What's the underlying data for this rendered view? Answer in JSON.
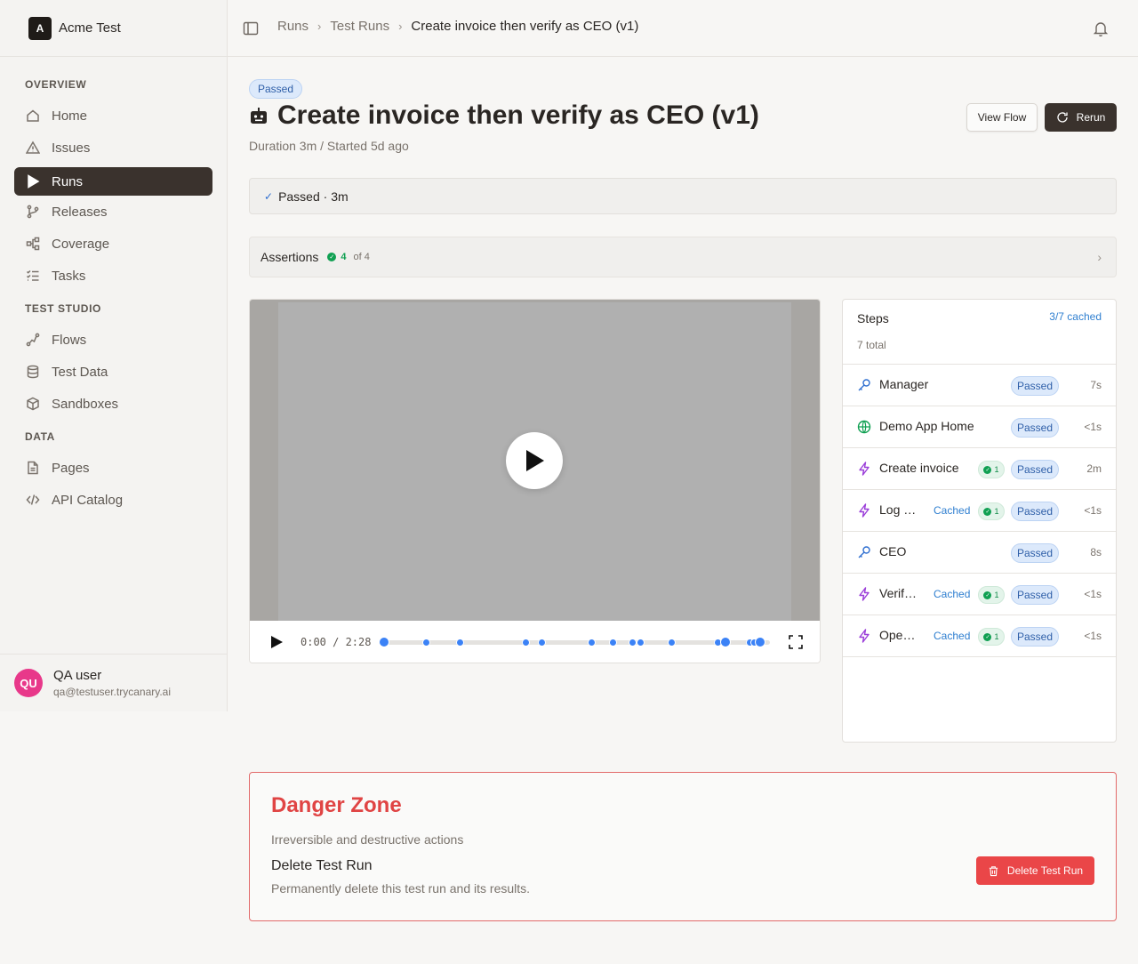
{
  "workspace": {
    "logo_letter": "A",
    "name": "Acme Test"
  },
  "sidebar": {
    "sections": [
      {
        "title": "OVERVIEW"
      },
      {
        "title": "TEST STUDIO"
      },
      {
        "title": "DATA"
      }
    ],
    "items": [
      {
        "label": "Home",
        "icon": "home-icon"
      },
      {
        "label": "Issues",
        "icon": "warning-icon"
      },
      {
        "label": "Runs",
        "icon": "play-icon",
        "active": true
      },
      {
        "label": "Releases",
        "icon": "git-branch-icon"
      },
      {
        "label": "Coverage",
        "icon": "workflow-icon"
      },
      {
        "label": "Tasks",
        "icon": "checklist-icon"
      },
      {
        "label": "Flows",
        "icon": "route-icon"
      },
      {
        "label": "Test Data",
        "icon": "database-icon"
      },
      {
        "label": "Sandboxes",
        "icon": "box-icon"
      },
      {
        "label": "Pages",
        "icon": "file-icon"
      },
      {
        "label": "API Catalog",
        "icon": "code-icon"
      }
    ],
    "user": {
      "initials": "QU",
      "name": "QA user",
      "email": "qa@testuser.trycanary.ai"
    }
  },
  "breadcrumb": [
    "Runs",
    "Test Runs",
    "Create invoice then verify as CEO (v1)"
  ],
  "header": {
    "status_badge": "Passed",
    "title": "Create invoice then verify as CEO (v1)",
    "subtitle": "Duration 3m / Started 5d ago",
    "view_flow_label": "View Flow",
    "rerun_label": "Rerun"
  },
  "status_bar": {
    "text": "Passed · 3m"
  },
  "assertions": {
    "label": "Assertions",
    "passed": "4",
    "total_text": "of 4"
  },
  "video": {
    "current_time": "0:00",
    "duration": "2:28",
    "time_text": "0:00 / 2:28",
    "markers": [
      0.0,
      0.113,
      0.202,
      0.374,
      0.416,
      0.546,
      0.6,
      0.653,
      0.674,
      0.755,
      0.875,
      0.897,
      0.958,
      0.97,
      0.988
    ],
    "accent": "#3b82f6"
  },
  "steps": {
    "title": "Steps",
    "cached_summary": "3/7 cached",
    "total_text": "7 total",
    "items": [
      {
        "name": "Manager",
        "icon": "key-icon",
        "cached": "",
        "assertions": "",
        "status": "Passed",
        "duration": "7s"
      },
      {
        "name": "Demo App Home",
        "icon": "globe-icon",
        "cached": "",
        "assertions": "",
        "status": "Passed",
        "duration": "<1s"
      },
      {
        "name": "Create invoice",
        "icon": "lightning-icon",
        "cached": "",
        "assertions": "1",
        "status": "Passed",
        "duration": "2m"
      },
      {
        "name": "Log …",
        "icon": "lightning-icon",
        "cached": "Cached",
        "assertions": "1",
        "status": "Passed",
        "duration": "<1s"
      },
      {
        "name": "CEO",
        "icon": "key-icon",
        "cached": "",
        "assertions": "",
        "status": "Passed",
        "duration": "8s"
      },
      {
        "name": "Verif…",
        "icon": "lightning-icon",
        "cached": "Cached",
        "assertions": "1",
        "status": "Passed",
        "duration": "<1s"
      },
      {
        "name": "Ope…",
        "icon": "lightning-icon",
        "cached": "Cached",
        "assertions": "1",
        "status": "Passed",
        "duration": "<1s"
      }
    ]
  },
  "danger_zone": {
    "title": "Danger Zone",
    "subtitle": "Irreversible and destructive actions",
    "action_title": "Delete Test Run",
    "action_desc": "Permanently delete this test run and its results.",
    "button_label": "Delete Test Run"
  },
  "colors": {
    "brand_dark": "#3a322d",
    "danger": "#ea4648",
    "success": "#10a052",
    "link": "#2f7fd0"
  }
}
